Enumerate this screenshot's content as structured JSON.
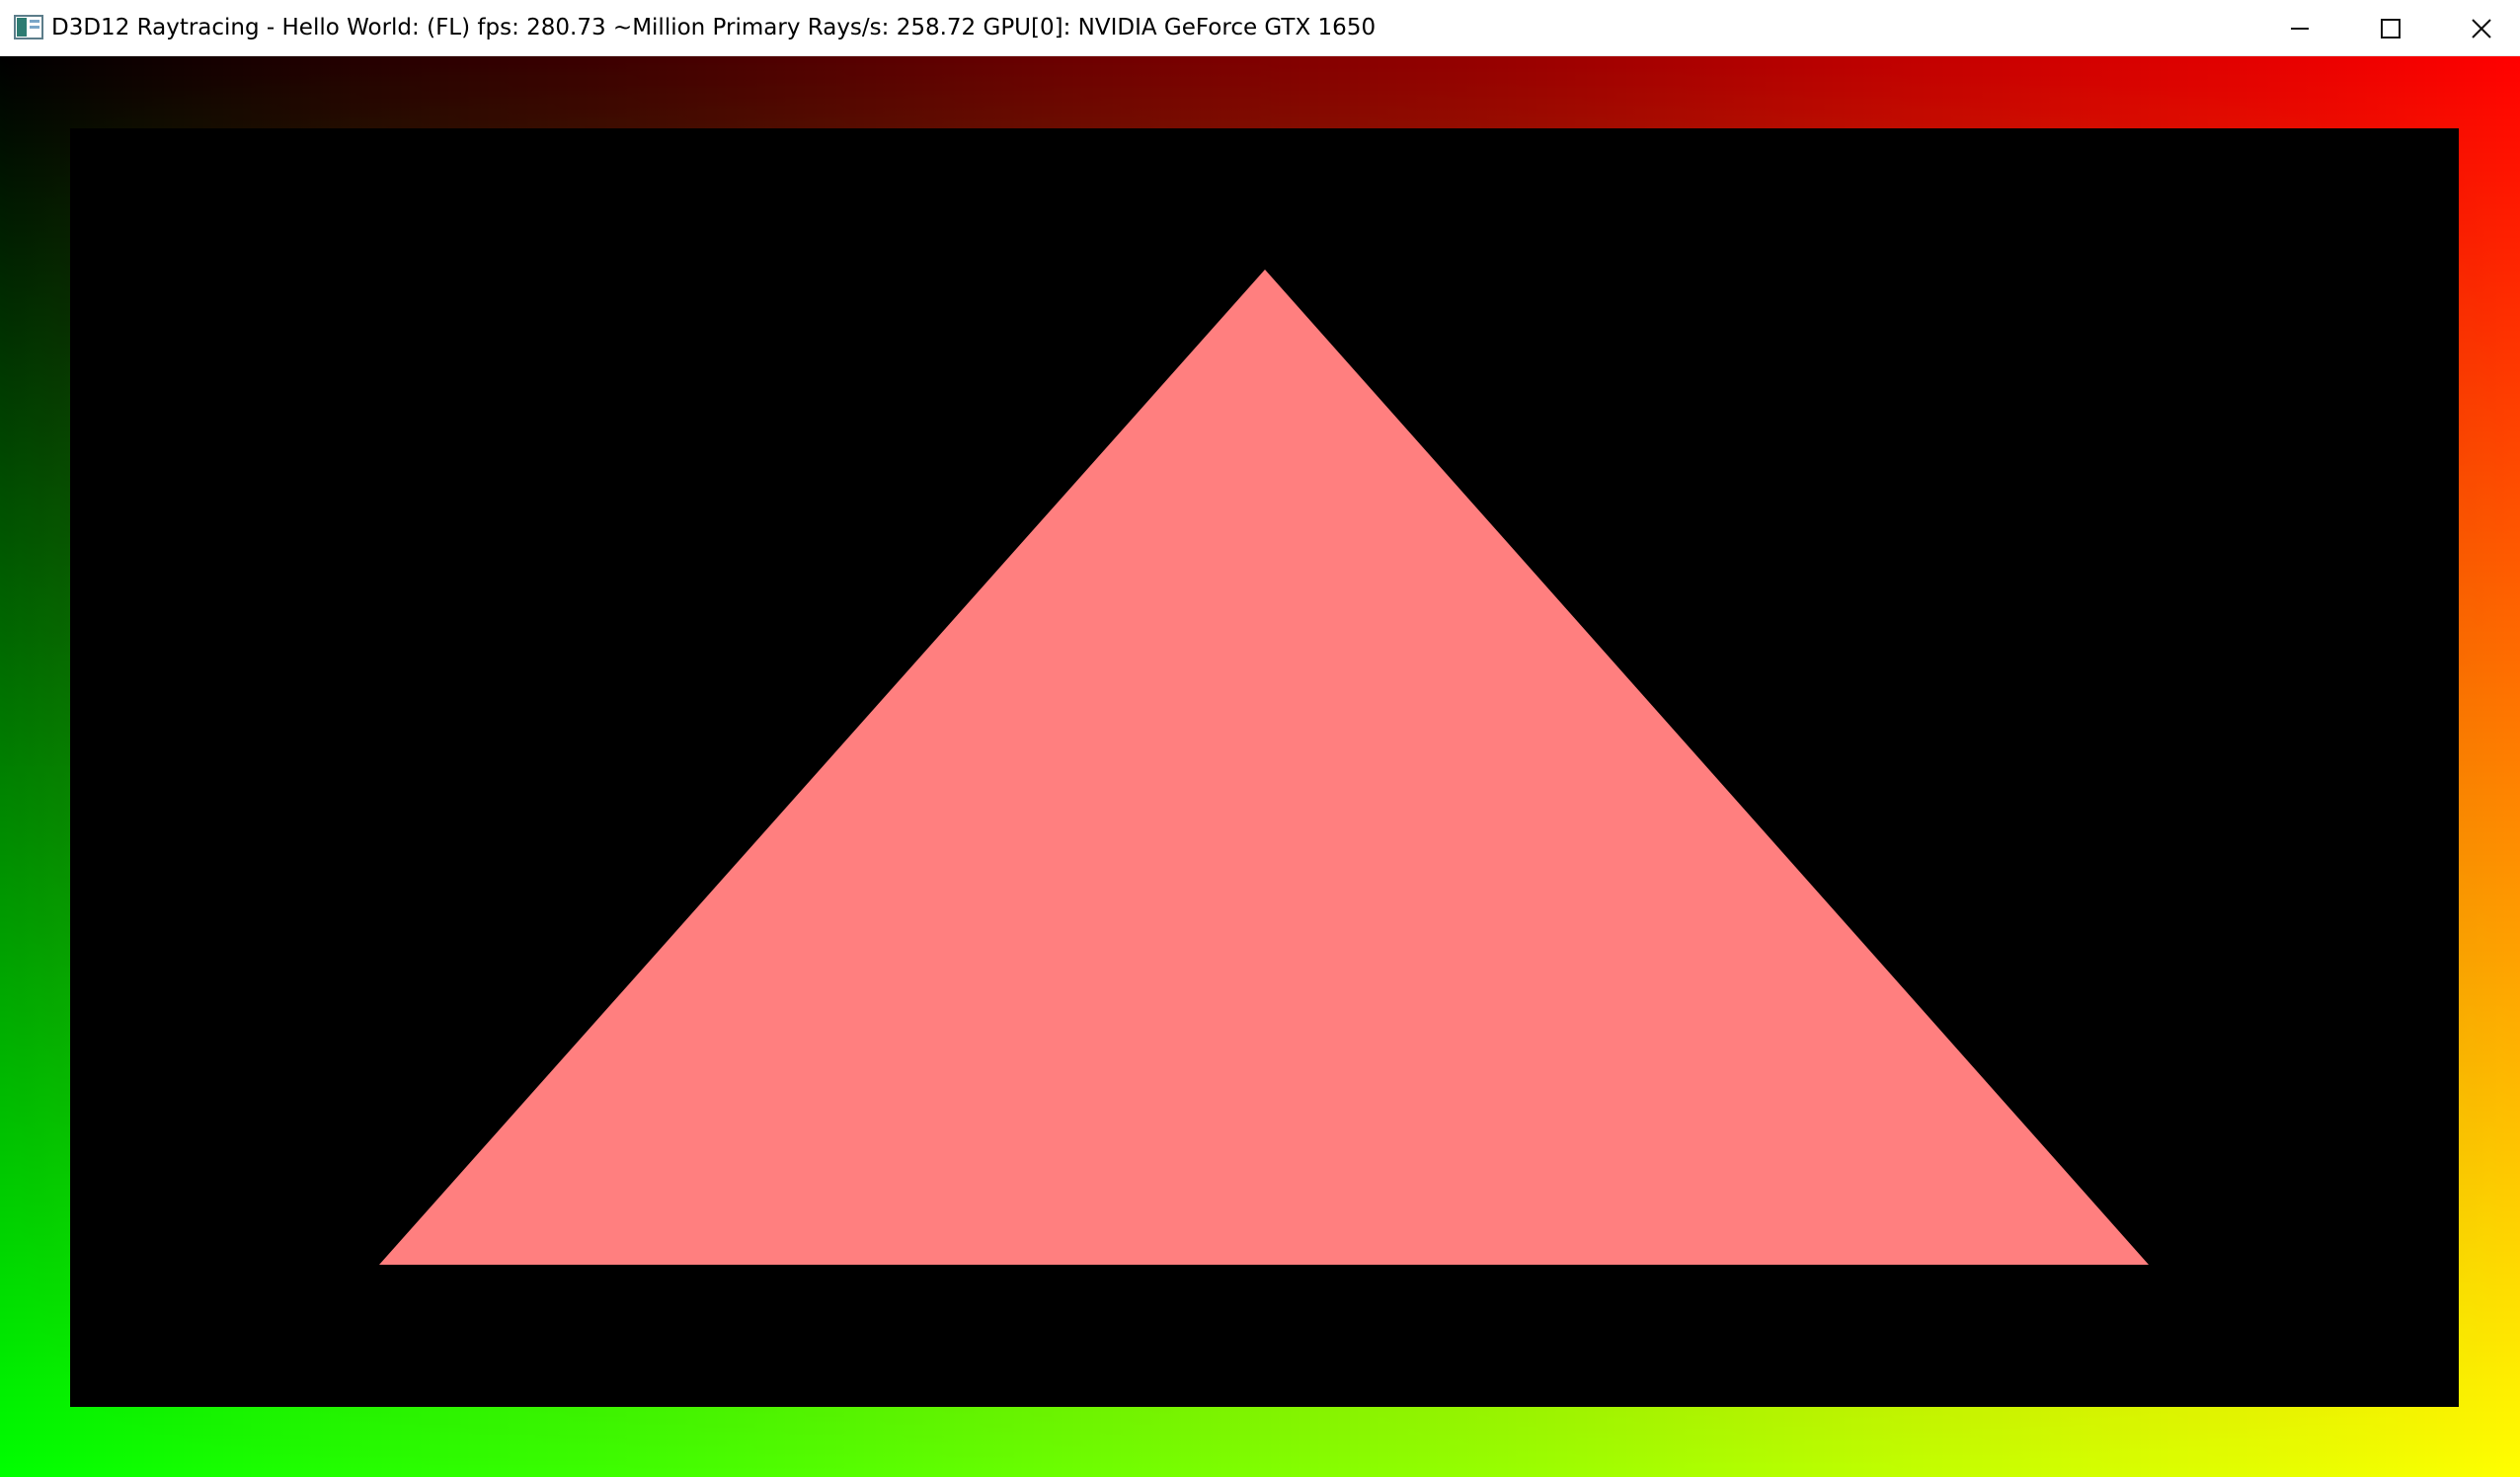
{
  "window": {
    "title_text": "D3D12 Raytracing - Hello World: (FL)      fps: 280.73      ~Million Primary Rays/s: 258.72      GPU[0]: NVIDIA GeForce GTX 1650",
    "app_icon": "d3d12-app-icon",
    "controls": {
      "minimize_icon": "minimize-icon",
      "maximize_icon": "maximize-icon",
      "close_icon": "close-icon"
    }
  },
  "render": {
    "background_colors": {
      "top_left": "#000000",
      "top_right": "#ff0000",
      "bottom_left": "#00ff00",
      "bottom_right": "#ffff00"
    },
    "inner_viewport_color": "#000000",
    "triangle_color": "#ff7f7f"
  }
}
